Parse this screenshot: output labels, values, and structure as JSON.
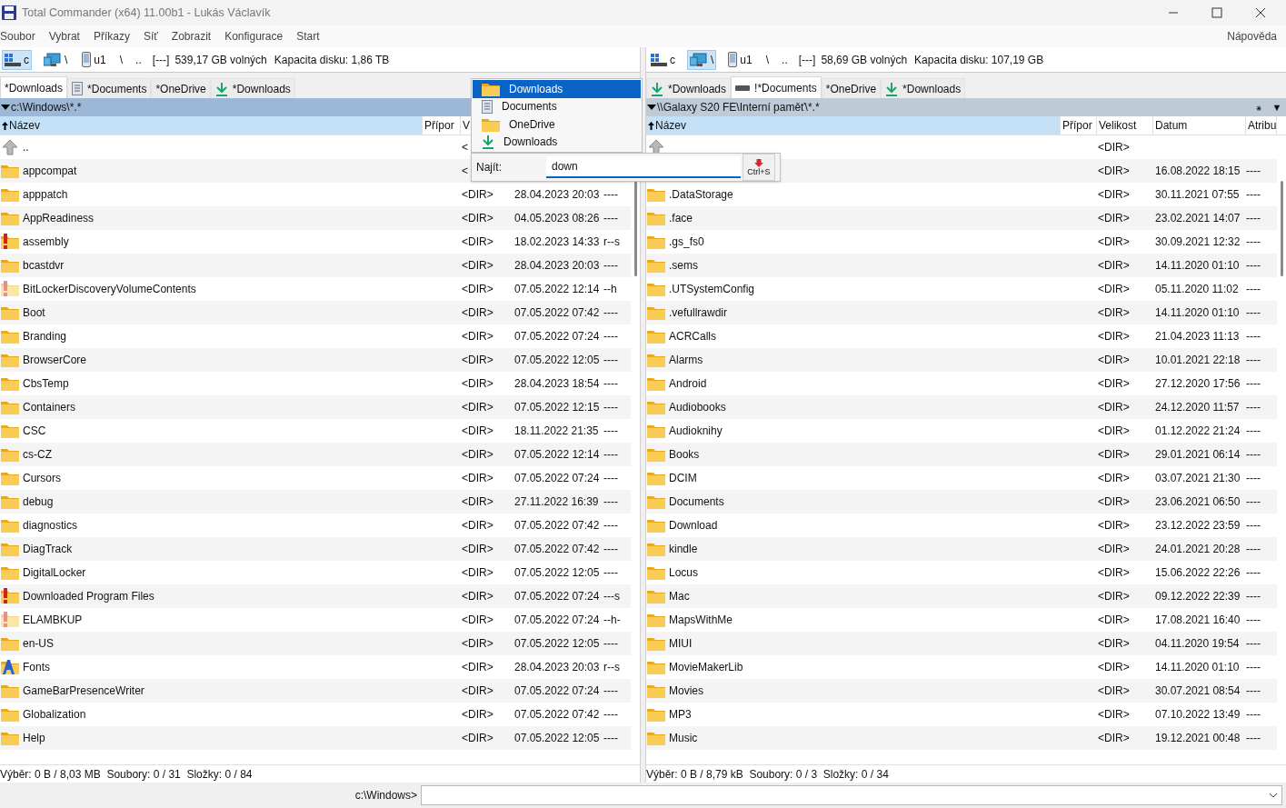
{
  "window": {
    "title": "Total Commander (x64) 11.00b1 - Lukás Václavík"
  },
  "menu": {
    "items": [
      "Soubor",
      "Vybrat",
      "Příkazy",
      "Síť",
      "Zobrazit",
      "Konfigurace",
      "Start"
    ],
    "help": "Nápověda"
  },
  "panels": [
    {
      "drive_bar": {
        "drives": [
          {
            "kind": "disk",
            "label": "c",
            "selected": true
          },
          {
            "kind": "network",
            "label": "\\",
            "selected": false
          },
          {
            "kind": "phone",
            "label": "u1",
            "selected": false
          }
        ],
        "root": "\\",
        "up": "..",
        "volume": "[---]",
        "free": "539,17 GB volných",
        "capacity": "Kapacita disku: 1,86 TB"
      },
      "tabs": [
        {
          "label": "*Downloads",
          "kind": "plain",
          "selected": true
        },
        {
          "label": "*Documents",
          "kind": "document",
          "selected": false
        },
        {
          "label": "*OneDrive",
          "kind": "plain",
          "selected": false
        },
        {
          "label": "*Downloads",
          "kind": "download",
          "selected": false
        }
      ],
      "path": "c:\\Windows\\*.*",
      "active": true,
      "columns": [
        {
          "label": "Název",
          "sorted": true
        },
        {
          "label": "Přípor",
          "sorted": false
        },
        {
          "label": "V",
          "sorted": false
        }
      ],
      "rows": [
        {
          "kind": "up",
          "name": "..",
          "size": "<"
        },
        {
          "kind": "folder",
          "name": "appcompat",
          "size": "<"
        },
        {
          "kind": "folder",
          "name": "apppatch",
          "size": "<DIR>",
          "date": "28.04.2023 20:03",
          "attr": "----"
        },
        {
          "kind": "folder",
          "name": "AppReadiness",
          "size": "<DIR>",
          "date": "04.05.2023 08:26",
          "attr": "----"
        },
        {
          "kind": "system",
          "name": "assembly",
          "size": "<DIR>",
          "date": "18.02.2023 14:33",
          "attr": "r--s"
        },
        {
          "kind": "folder",
          "name": "bcastdvr",
          "size": "<DIR>",
          "date": "28.04.2023 20:03",
          "attr": "----"
        },
        {
          "kind": "hidden",
          "name": "BitLockerDiscoveryVolumeContents",
          "size": "<DIR>",
          "date": "07.05.2022 12:14",
          "attr": "--h"
        },
        {
          "kind": "folder",
          "name": "Boot",
          "size": "<DIR>",
          "date": "07.05.2022 07:42",
          "attr": "----"
        },
        {
          "kind": "folder",
          "name": "Branding",
          "size": "<DIR>",
          "date": "07.05.2022 07:24",
          "attr": "----"
        },
        {
          "kind": "folder",
          "name": "BrowserCore",
          "size": "<DIR>",
          "date": "07.05.2022 12:05",
          "attr": "----"
        },
        {
          "kind": "folder",
          "name": "CbsTemp",
          "size": "<DIR>",
          "date": "28.04.2023 18:54",
          "attr": "----"
        },
        {
          "kind": "folder",
          "name": "Containers",
          "size": "<DIR>",
          "date": "07.05.2022 12:15",
          "attr": "----"
        },
        {
          "kind": "folder",
          "name": "CSC",
          "size": "<DIR>",
          "date": "18.11.2022 21:35",
          "attr": "----"
        },
        {
          "kind": "folder",
          "name": "cs-CZ",
          "size": "<DIR>",
          "date": "07.05.2022 12:14",
          "attr": "----"
        },
        {
          "kind": "folder",
          "name": "Cursors",
          "size": "<DIR>",
          "date": "07.05.2022 07:24",
          "attr": "----"
        },
        {
          "kind": "folder",
          "name": "debug",
          "size": "<DIR>",
          "date": "27.11.2022 16:39",
          "attr": "----"
        },
        {
          "kind": "folder",
          "name": "diagnostics",
          "size": "<DIR>",
          "date": "07.05.2022 07:42",
          "attr": "----"
        },
        {
          "kind": "folder",
          "name": "DiagTrack",
          "size": "<DIR>",
          "date": "07.05.2022 07:42",
          "attr": "----"
        },
        {
          "kind": "folder",
          "name": "DigitalLocker",
          "size": "<DIR>",
          "date": "07.05.2022 12:05",
          "attr": "----"
        },
        {
          "kind": "system",
          "name": "Downloaded Program Files",
          "size": "<DIR>",
          "date": "07.05.2022 07:24",
          "attr": "---s"
        },
        {
          "kind": "hidden",
          "name": "ELAMBKUP",
          "size": "<DIR>",
          "date": "07.05.2022 07:24",
          "attr": "--h-"
        },
        {
          "kind": "folder",
          "name": "en-US",
          "size": "<DIR>",
          "date": "07.05.2022 12:05",
          "attr": "----"
        },
        {
          "kind": "fonts",
          "name": "Fonts",
          "size": "<DIR>",
          "date": "28.04.2023 20:03",
          "attr": "r--s"
        },
        {
          "kind": "folder",
          "name": "GameBarPresenceWriter",
          "size": "<DIR>",
          "date": "07.05.2022 07:24",
          "attr": "----"
        },
        {
          "kind": "folder",
          "name": "Globalization",
          "size": "<DIR>",
          "date": "07.05.2022 07:42",
          "attr": "----"
        },
        {
          "kind": "folder",
          "name": "Help",
          "size": "<DIR>",
          "date": "07.05.2022 12:05",
          "attr": "----"
        }
      ],
      "status": "Výběr: 0 B / 8,03 MB  Soubory: 0 / 31  Složky: 0 / 84"
    },
    {
      "drive_bar": {
        "drives": [
          {
            "kind": "disk",
            "label": "c",
            "selected": false
          },
          {
            "kind": "network",
            "label": "\\",
            "selected": true
          },
          {
            "kind": "phone",
            "label": "u1",
            "selected": false
          }
        ],
        "root": "\\",
        "up": "..",
        "volume": "[---]",
        "free": "58,69 GB volných",
        "capacity": "Kapacita disku: 107,19 GB"
      },
      "tabs": [
        {
          "label": "*Downloads",
          "kind": "download",
          "selected": false
        },
        {
          "label": "!*Documents",
          "kind": "drive",
          "selected": true
        },
        {
          "label": "*OneDrive",
          "kind": "plain",
          "selected": false
        },
        {
          "label": "*Downloads",
          "kind": "download",
          "selected": false
        }
      ],
      "path": "\\\\Galaxy S20 FE\\Interní paměť\\*.*",
      "active": false,
      "path_buttons": [
        "⁕",
        "▼"
      ],
      "columns": [
        {
          "label": "Název",
          "sorted": true
        },
        {
          "label": "Přípor",
          "sorted": false
        },
        {
          "label": "Velikost",
          "sorted": false
        },
        {
          "label": "Datum",
          "sorted": false
        },
        {
          "label": "Atribu",
          "sorted": false
        }
      ],
      "rows": [
        {
          "kind": "up",
          "size": "<DIR>"
        },
        {
          "kind": "hidden-row",
          "size": "<DIR>",
          "date": "16.08.2022 18:15",
          "attr": "----"
        },
        {
          "kind": "folder",
          "name": ".DataStorage",
          "size": "<DIR>",
          "date": "30.11.2021 07:55",
          "attr": "----"
        },
        {
          "kind": "folder",
          "name": ".face",
          "size": "<DIR>",
          "date": "23.02.2021 14:07",
          "attr": "----"
        },
        {
          "kind": "folder",
          "name": ".gs_fs0",
          "size": "<DIR>",
          "date": "30.09.2021 12:32",
          "attr": "----"
        },
        {
          "kind": "folder",
          "name": ".sems",
          "size": "<DIR>",
          "date": "14.11.2020 01:10",
          "attr": "----"
        },
        {
          "kind": "folder",
          "name": ".UTSystemConfig",
          "size": "<DIR>",
          "date": "05.11.2020 11:02",
          "attr": "----"
        },
        {
          "kind": "folder",
          "name": ".vefullrawdir",
          "size": "<DIR>",
          "date": "14.11.2020 01:10",
          "attr": "----"
        },
        {
          "kind": "folder",
          "name": "ACRCalls",
          "size": "<DIR>",
          "date": "21.04.2023 11:13",
          "attr": "----"
        },
        {
          "kind": "folder",
          "name": "Alarms",
          "size": "<DIR>",
          "date": "10.01.2021 22:18",
          "attr": "----"
        },
        {
          "kind": "folder",
          "name": "Android",
          "size": "<DIR>",
          "date": "27.12.2020 17:56",
          "attr": "----"
        },
        {
          "kind": "folder",
          "name": "Audiobooks",
          "size": "<DIR>",
          "date": "24.12.2020 11:57",
          "attr": "----"
        },
        {
          "kind": "folder",
          "name": "Audioknihy",
          "size": "<DIR>",
          "date": "01.12.2022 21:24",
          "attr": "----"
        },
        {
          "kind": "folder",
          "name": "Books",
          "size": "<DIR>",
          "date": "29.01.2021 06:14",
          "attr": "----"
        },
        {
          "kind": "folder",
          "name": "DCIM",
          "size": "<DIR>",
          "date": "03.07.2021 21:30",
          "attr": "----"
        },
        {
          "kind": "folder",
          "name": "Documents",
          "size": "<DIR>",
          "date": "23.06.2021 06:50",
          "attr": "----"
        },
        {
          "kind": "folder",
          "name": "Download",
          "size": "<DIR>",
          "date": "23.12.2022 23:59",
          "attr": "----"
        },
        {
          "kind": "folder",
          "name": "kindle",
          "size": "<DIR>",
          "date": "24.01.2021 20:28",
          "attr": "----"
        },
        {
          "kind": "folder",
          "name": "Locus",
          "size": "<DIR>",
          "date": "15.06.2022 22:26",
          "attr": "----"
        },
        {
          "kind": "folder",
          "name": "Mac",
          "size": "<DIR>",
          "date": "09.12.2022 22:39",
          "attr": "----"
        },
        {
          "kind": "folder",
          "name": "MapsWithMe",
          "size": "<DIR>",
          "date": "17.08.2021 16:40",
          "attr": "----"
        },
        {
          "kind": "folder",
          "name": "MIUI",
          "size": "<DIR>",
          "date": "04.11.2020 19:54",
          "attr": "----"
        },
        {
          "kind": "folder",
          "name": "MovieMakerLib",
          "size": "<DIR>",
          "date": "14.11.2020 01:10",
          "attr": "----"
        },
        {
          "kind": "folder",
          "name": "Movies",
          "size": "<DIR>",
          "date": "30.07.2021 08:54",
          "attr": "----"
        },
        {
          "kind": "folder",
          "name": "MP3",
          "size": "<DIR>",
          "date": "07.10.2022 13:49",
          "attr": "----"
        },
        {
          "kind": "folder",
          "name": "Music",
          "size": "<DIR>",
          "date": "19.12.2021 00:48",
          "attr": "----"
        }
      ],
      "status": "Výběr: 0 B / 8,79 kB  Soubory: 0 / 3  Složky: 0 / 34"
    }
  ],
  "popup": {
    "items": [
      {
        "label": "Downloads",
        "kind": "folder",
        "selected": true
      },
      {
        "label": "Documents",
        "kind": "document",
        "selected": false
      },
      {
        "label": "OneDrive",
        "kind": "folder",
        "selected": false
      },
      {
        "label": "Downloads",
        "kind": "download",
        "selected": false
      }
    ],
    "find_label": "Najít:",
    "find_value": "down",
    "button": "Ctrl+S"
  },
  "command_line": {
    "prompt": "c:\\Windows>"
  }
}
